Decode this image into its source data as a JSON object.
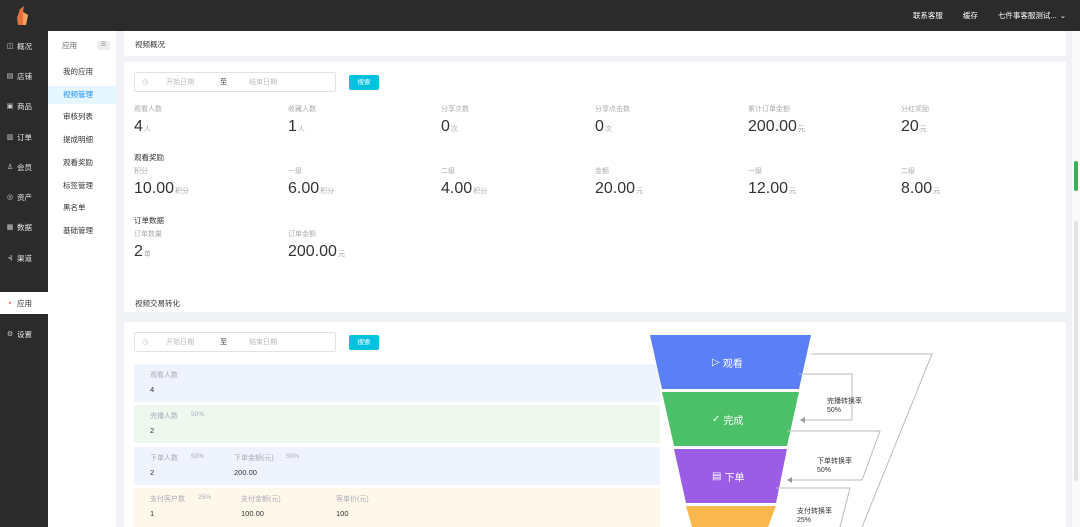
{
  "topbar": {
    "links": [
      "联系客服",
      "缓存"
    ],
    "user": "七件事客服测试..."
  },
  "sidebar": {
    "items": [
      {
        "icon": "dashboard-icon",
        "glyph": "◫",
        "label": "概况"
      },
      {
        "icon": "store-icon",
        "glyph": "▤",
        "label": "店铺"
      },
      {
        "icon": "goods-icon",
        "glyph": "▣",
        "label": "商品"
      },
      {
        "icon": "order-icon",
        "glyph": "▥",
        "label": "订单"
      },
      {
        "icon": "member-icon",
        "glyph": "♙",
        "label": "会员"
      },
      {
        "icon": "asset-icon",
        "glyph": "◎",
        "label": "资产"
      },
      {
        "icon": "data-icon",
        "glyph": "▦",
        "label": "数据"
      },
      {
        "icon": "channel-icon",
        "glyph": "⊰",
        "label": "渠道"
      },
      {
        "icon": "apps-icon",
        "glyph": "▪",
        "label": "应用"
      },
      {
        "icon": "settings-icon",
        "glyph": "⚙",
        "label": "设置"
      }
    ]
  },
  "subnav": {
    "title": "应用",
    "collapse_glyph": "☰",
    "links": [
      "我的应用",
      "视频管理",
      "审核列表",
      "提成明细",
      "观看奖励",
      "标签管理",
      "黑名单",
      "基础管理"
    ]
  },
  "overview": {
    "title": "视频概况",
    "date": {
      "start_placeholder": "开始日期",
      "to": "至",
      "end_placeholder": "结束日期"
    },
    "search_label": "搜索",
    "stats_row1": [
      {
        "label": "观看人数",
        "value": "4",
        "unit": "人"
      },
      {
        "label": "收藏人数",
        "value": "1",
        "unit": "人"
      },
      {
        "label": "分享次数",
        "value": "0",
        "unit": "次"
      },
      {
        "label": "分享点击数",
        "value": "0",
        "unit": "次"
      },
      {
        "label": "累计订单金额",
        "value": "200.00",
        "unit": "元"
      },
      {
        "label": "分红奖励",
        "value": "20",
        "unit": "元"
      }
    ],
    "reward_title": "观看奖励",
    "stats_row2": [
      {
        "label": "积分",
        "value": "10.00",
        "unit": "积分"
      },
      {
        "label": "一级",
        "value": "6.00",
        "unit": "积分"
      },
      {
        "label": "二级",
        "value": "4.00",
        "unit": "积分"
      },
      {
        "label": "金额",
        "value": "20.00",
        "unit": "元"
      },
      {
        "label": "一级",
        "value": "12.00",
        "unit": "元"
      },
      {
        "label": "二级",
        "value": "8.00",
        "unit": "元"
      }
    ],
    "order_title": "订单数据",
    "stats_row3": [
      {
        "label": "订单数量",
        "value": "2",
        "unit": "单"
      },
      {
        "label": "订单金额",
        "value": "200.00",
        "unit": "元"
      }
    ]
  },
  "conversion": {
    "title": "视频交易转化",
    "date": {
      "start_placeholder": "开始日期",
      "to": "至",
      "end_placeholder": "结束日期"
    },
    "search_label": "搜索",
    "rows": [
      {
        "bg": "#eef3fe",
        "cells": [
          {
            "label": "观看人数",
            "value": "4"
          }
        ]
      },
      {
        "bg": "#eef8ef",
        "cells": [
          {
            "label": "完播人数",
            "pct": "50%",
            "value": "2"
          }
        ]
      },
      {
        "bg": "#eef3fe",
        "cells": [
          {
            "label": "下单人数",
            "pct": "50%",
            "value": "2"
          },
          {
            "label": "下单金额(元)",
            "pct": "50%",
            "value": "200.00"
          }
        ]
      },
      {
        "bg": "#fff8ea",
        "cells": [
          {
            "label": "支付客户数",
            "pct": "25%",
            "value": "1"
          },
          {
            "label": "支付金额(元)",
            "value": "100.00"
          },
          {
            "label": "客单价(元)",
            "value": "100"
          }
        ]
      }
    ],
    "funnel": {
      "stages": [
        {
          "label": "观看",
          "color": "#5b80f5",
          "icon": "play-circle-icon",
          "glyph": "▷"
        },
        {
          "label": "完成",
          "color": "#4cc068",
          "icon": "check-circle-icon",
          "glyph": "✓"
        },
        {
          "label": "下单",
          "color": "#9b5de5",
          "icon": "order-form-icon",
          "glyph": "▤"
        },
        {
          "label": "",
          "color": "#f8b84e",
          "icon": "",
          "glyph": ""
        }
      ],
      "rates": [
        {
          "name": "完播转换率",
          "value": "50%"
        },
        {
          "name": "下单转换率",
          "value": "50%"
        },
        {
          "name": "支付转换率",
          "value": "25%"
        }
      ]
    }
  }
}
